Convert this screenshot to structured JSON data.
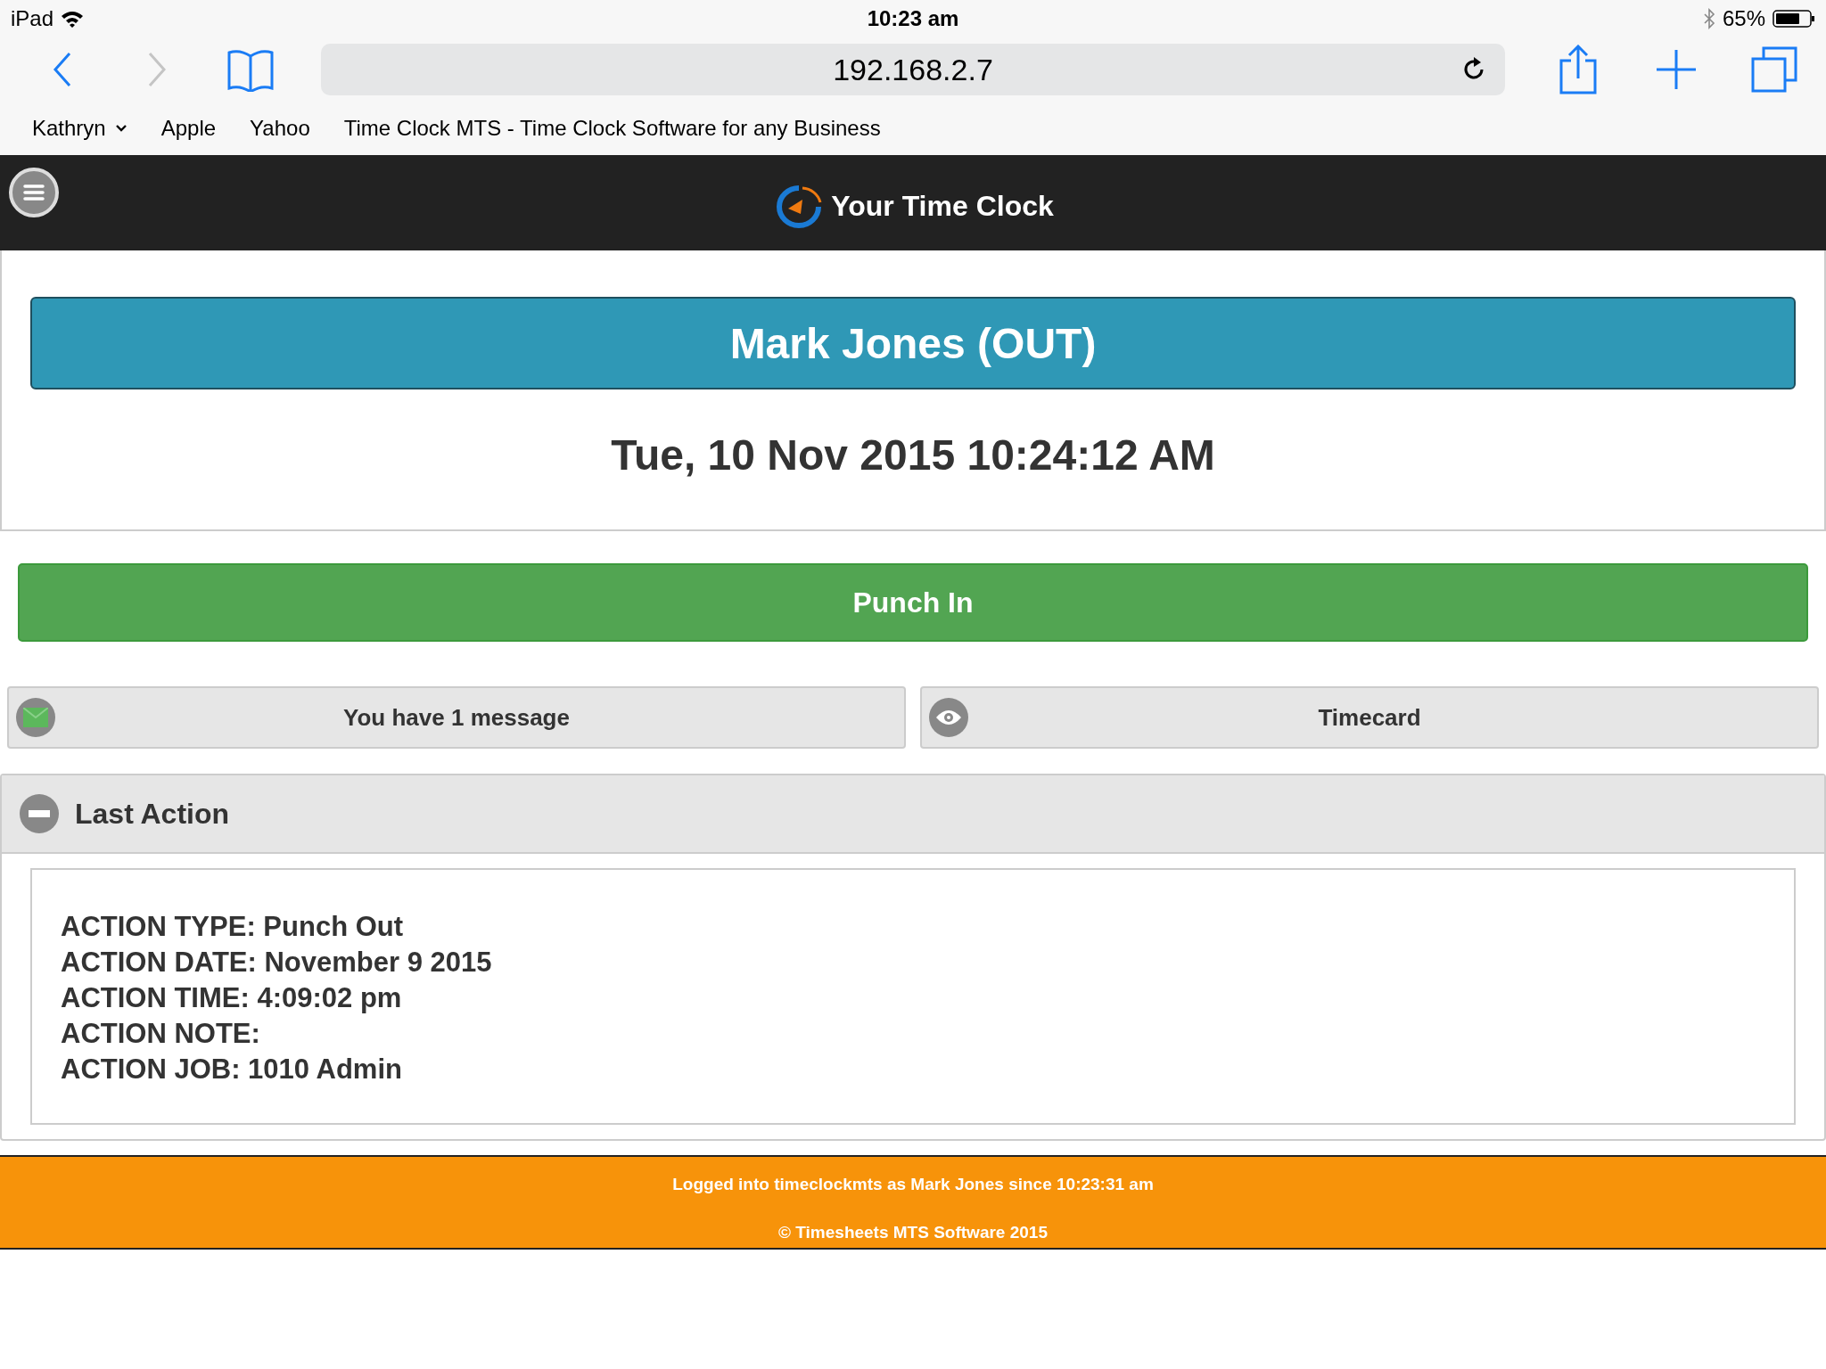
{
  "status_bar": {
    "device": "iPad",
    "time": "10:23 am",
    "battery": "65%"
  },
  "browser": {
    "address": "192.168.2.7",
    "bookmarks": [
      {
        "label": "Kathryn",
        "kind": "folder"
      },
      {
        "label": "Apple",
        "kind": "link"
      },
      {
        "label": "Yahoo",
        "kind": "link"
      },
      {
        "label": "Time Clock MTS - Time Clock Software for any Business",
        "kind": "link"
      }
    ]
  },
  "header": {
    "title": "Your Time Clock"
  },
  "employee": {
    "banner": "Mark Jones (OUT)",
    "datetime": "Tue, 10 Nov 2015 10:24:12 AM"
  },
  "punch_button": "Punch In",
  "buttons": [
    {
      "label": "You have 1 message",
      "kind": "message"
    },
    {
      "label": "Timecard",
      "kind": "timecard"
    }
  ],
  "last_action": {
    "title": "Last Action",
    "expanded": true,
    "lines": [
      "ACTION TYPE: Punch Out",
      "ACTION DATE: November 9 2015",
      "ACTION TIME: 4:09:02 pm",
      "ACTION NOTE:",
      "ACTION JOB: 1010 Admin"
    ]
  },
  "footer": {
    "lines": [
      "Logged into timeclockmts as Mark Jones since 10:23:31 am",
      "© Timesheets MTS Software 2015"
    ]
  }
}
